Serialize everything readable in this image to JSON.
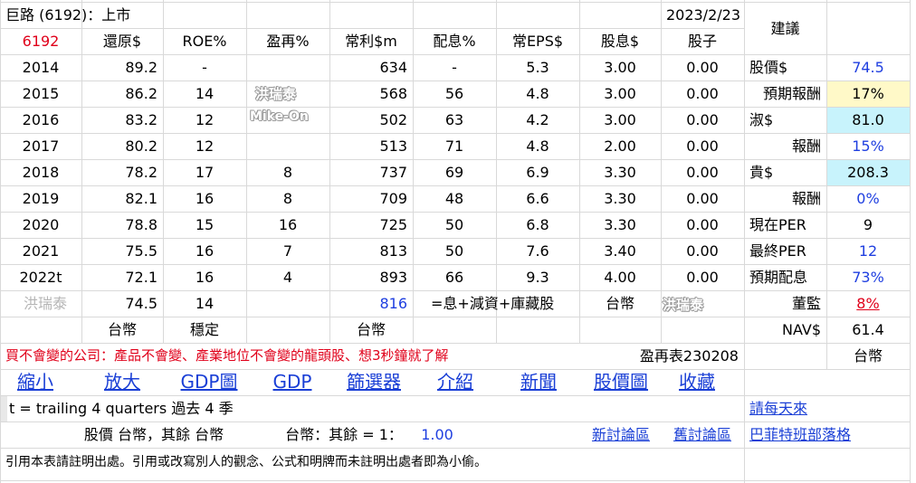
{
  "header": {
    "title": "巨路 (6192)：上市",
    "date": "2023/2/23",
    "suggest": "建議"
  },
  "columns": [
    "6192",
    "還原$",
    "ROE%",
    "盈再%",
    "常利$m",
    "配息%",
    "常EPS$",
    "股息$",
    "股子"
  ],
  "rows": [
    {
      "year": "2014",
      "restore": "89.2",
      "roe": "-",
      "reinvest": "",
      "profit": "634",
      "payout": "-",
      "eps": "5.3",
      "div": "3.00",
      "stock": "0.00"
    },
    {
      "year": "2015",
      "restore": "86.2",
      "roe": "14",
      "reinvest": "",
      "profit": "568",
      "payout": "56",
      "eps": "4.8",
      "div": "3.00",
      "stock": "0.00"
    },
    {
      "year": "2016",
      "restore": "83.2",
      "roe": "12",
      "reinvest": "",
      "profit": "502",
      "payout": "63",
      "eps": "4.2",
      "div": "3.00",
      "stock": "0.00"
    },
    {
      "year": "2017",
      "restore": "80.2",
      "roe": "12",
      "reinvest": "",
      "profit": "513",
      "payout": "71",
      "eps": "4.8",
      "div": "2.00",
      "stock": "0.00"
    },
    {
      "year": "2018",
      "restore": "78.2",
      "roe": "17",
      "reinvest": "8",
      "profit": "737",
      "payout": "69",
      "eps": "6.9",
      "div": "3.30",
      "stock": "0.00"
    },
    {
      "year": "2019",
      "restore": "82.1",
      "roe": "16",
      "reinvest": "8",
      "profit": "709",
      "payout": "48",
      "eps": "6.6",
      "div": "3.30",
      "stock": "0.00"
    },
    {
      "year": "2020",
      "restore": "78.8",
      "roe": "15",
      "reinvest": "16",
      "profit": "725",
      "payout": "50",
      "eps": "6.8",
      "div": "3.30",
      "stock": "0.00"
    },
    {
      "year": "2021",
      "restore": "75.5",
      "roe": "16",
      "reinvest": "7",
      "profit": "813",
      "payout": "50",
      "eps": "7.6",
      "div": "3.40",
      "stock": "0.00"
    },
    {
      "year": "2022t",
      "restore": "72.1",
      "roe": "16",
      "reinvest": "4",
      "profit": "893",
      "payout": "66",
      "eps": "9.3",
      "div": "4.00",
      "stock": "0.00"
    }
  ],
  "summary_row": {
    "name": "洪瑞泰",
    "restore": "74.5",
    "roe": "14",
    "profit": "816",
    "formula": "=息+減資+庫藏股",
    "currency": "台幣"
  },
  "units_row": {
    "restore_unit": "台幣",
    "roe_note": "穩定",
    "profit_unit": "台幣"
  },
  "side": [
    {
      "label": "股價$",
      "value": "74.5"
    },
    {
      "label": "預期報酬",
      "value": "17%"
    },
    {
      "label": "淑$",
      "value": "81.0"
    },
    {
      "label": "報酬",
      "value": "15%"
    },
    {
      "label": "貴$",
      "value": "208.3"
    },
    {
      "label": "報酬",
      "value": "0%"
    },
    {
      "label": "現在PER",
      "value": "9"
    },
    {
      "label": "最終PER",
      "value": "12"
    },
    {
      "label": "預期配息",
      "value": "73%"
    },
    {
      "label": "董監",
      "value": "8%"
    },
    {
      "label": "NAV$",
      "value": "61.4"
    }
  ],
  "side_extra": {
    "currency": "台幣"
  },
  "slogan": "買不會變的公司：產品不會變、產業地位不會變的龍頭股、想3秒鐘就了解",
  "table_code": "盈再表230208",
  "links": [
    "縮小",
    "放大",
    "GDP圖",
    "GDP",
    "篩選器",
    "介紹",
    "新聞",
    "股價圖",
    "收藏"
  ],
  "trailing_note": "t = trailing 4 quarters 過去 4 季",
  "daily_link": "請每天來",
  "currency_line": {
    "label1": "股價 台幣，其餘 台幣",
    "label2": "台幣：其餘 = 1：",
    "rate": "1.00"
  },
  "bottom_links": [
    "新討論區",
    "舊討論區",
    "巴菲特班部落格"
  ],
  "footer": "引用本表請註明出處。引用或改寫別人的觀念、公式和明牌而未註明出處者即為小偷。",
  "watermarks": [
    "洪瑞泰",
    "Mike-On",
    "洪瑞泰"
  ],
  "colors": {
    "red": "#e0001a",
    "blue": "#1f3fe0",
    "yellow_fill": "#fff9c8",
    "cyan_fill": "#c8f3fc"
  }
}
